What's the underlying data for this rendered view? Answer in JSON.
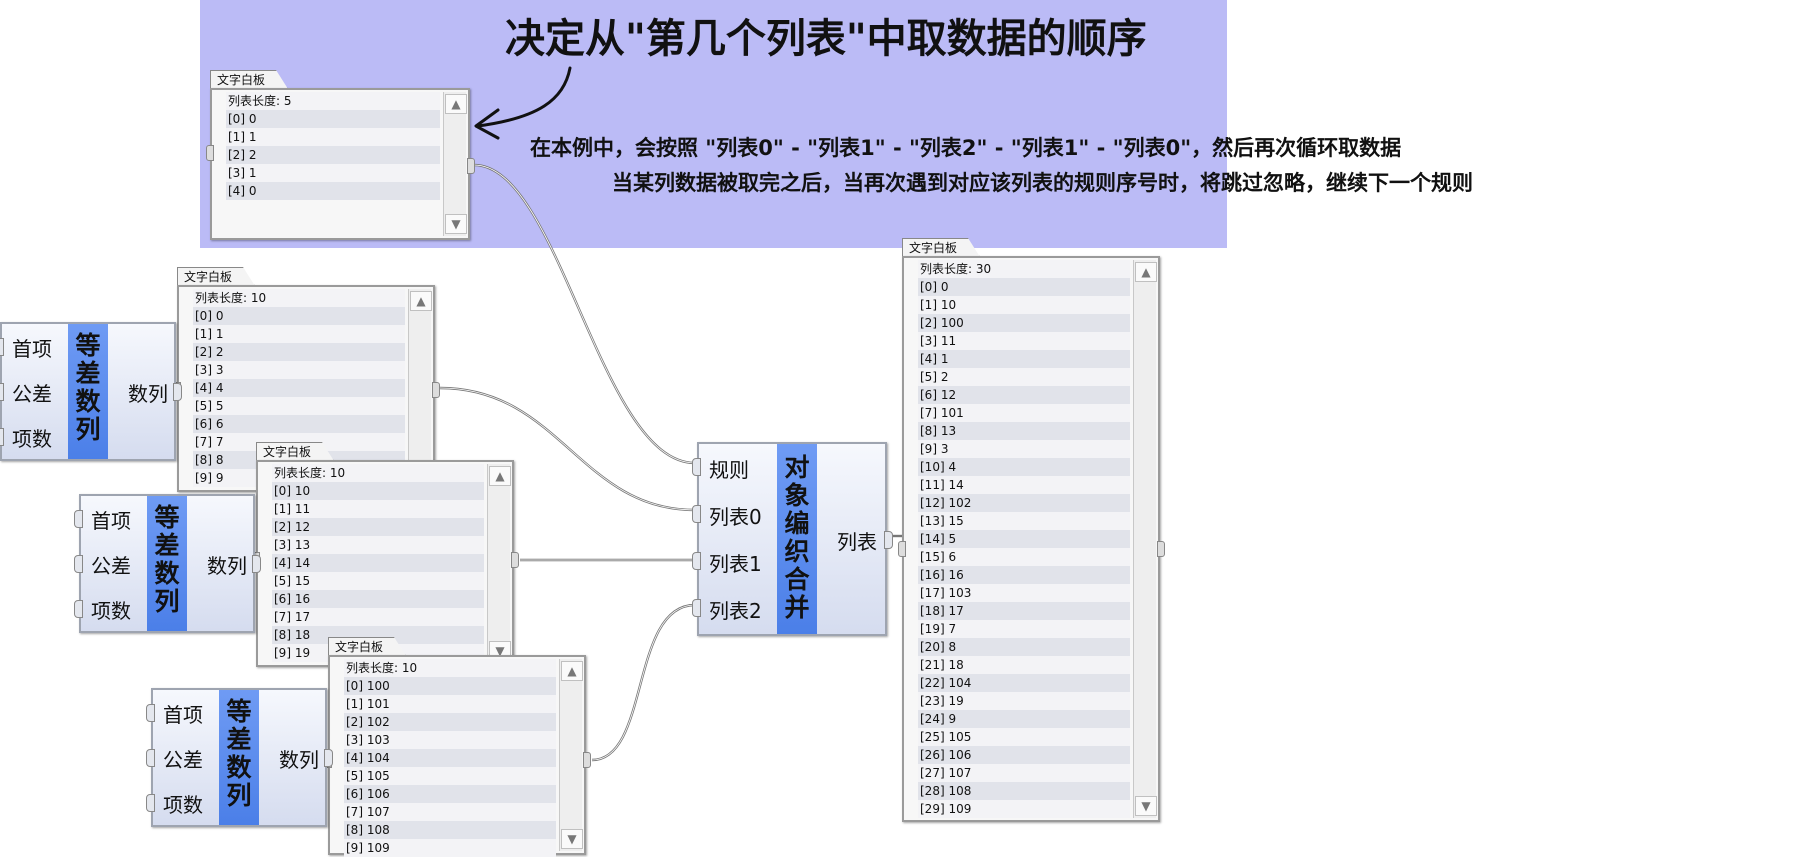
{
  "heading": {
    "title": "决定从\"第几个列表\"中取数据的顺序",
    "note_line1": "在本例中，会按照 \"列表0\" - \"列表1\" - \"列表2\" - \"列表1\" - \"列表0\"，然后再次循环取数据",
    "note_line2": "当某列数据被取完之后，当再次遇到对应该列表的规则序号时，将跳过忽略，继续下一个规则"
  },
  "panels": {
    "rule": {
      "tab": "文字白板",
      "rows": [
        "列表长度: 5",
        "[0] 0",
        "[1] 1",
        "[2] 2",
        "[3] 1",
        "[4] 0"
      ]
    },
    "list0": {
      "tab": "文字白板",
      "rows": [
        "列表长度: 10",
        "[0] 0",
        "[1] 1",
        "[2] 2",
        "[3] 3",
        "[4] 4",
        "[5] 5",
        "[6] 6",
        "[7] 7",
        "[8] 8",
        "[9] 9"
      ]
    },
    "list1": {
      "tab": "文字白板",
      "rows": [
        "列表长度: 10",
        "[0] 10",
        "[1] 11",
        "[2] 12",
        "[3] 13",
        "[4] 14",
        "[5] 15",
        "[6] 16",
        "[7] 17",
        "[8] 18",
        "[9] 19"
      ]
    },
    "list2": {
      "tab": "文字白板",
      "rows": [
        "列表长度: 10",
        "[0] 100",
        "[1] 101",
        "[2] 102",
        "[3] 103",
        "[4] 104",
        "[5] 105",
        "[6] 106",
        "[7] 107",
        "[8] 108",
        "[9] 109"
      ]
    },
    "result": {
      "tab": "文字白板",
      "rows": [
        "列表长度: 30",
        "[0] 0",
        "[1] 10",
        "[2] 100",
        "[3] 11",
        "[4] 1",
        "[5] 2",
        "[6] 12",
        "[7] 101",
        "[8] 13",
        "[9] 3",
        "[10] 4",
        "[11] 14",
        "[12] 102",
        "[13] 15",
        "[14] 5",
        "[15] 6",
        "[16] 16",
        "[17] 103",
        "[18] 17",
        "[19] 7",
        "[20] 8",
        "[21] 18",
        "[22] 104",
        "[23] 19",
        "[24] 9",
        "[25] 105",
        "[26] 106",
        "[27] 107",
        "[28] 108",
        "[29] 109"
      ]
    }
  },
  "arith_block": {
    "in_first": "首项",
    "in_diff": "公差",
    "in_count": "项数",
    "name_chars": [
      "等",
      "差",
      "数",
      "列"
    ],
    "out": "数列"
  },
  "merge_block": {
    "in_rule": "规则",
    "in_list0": "列表0",
    "in_list1": "列表1",
    "in_list2": "列表2",
    "name_chars": [
      "对",
      "象",
      "编",
      "织",
      "合",
      "并"
    ],
    "out": "列表"
  },
  "icons": {
    "scroll_up": "▲",
    "scroll_down": "▼",
    "pointer_arrow": "hand-drawn-arrow-icon"
  },
  "colors": {
    "highlight": "#bbbbf6",
    "block_bar": "#5b8df0",
    "wire": "#777777"
  }
}
